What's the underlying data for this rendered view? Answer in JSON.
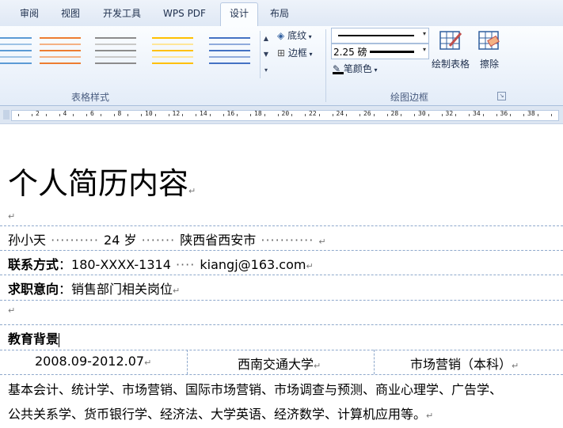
{
  "tabs": [
    {
      "label": "审阅",
      "active": false
    },
    {
      "label": "视图",
      "active": false
    },
    {
      "label": "开发工具",
      "active": false
    },
    {
      "label": "WPS PDF",
      "active": false
    },
    {
      "label": "设计",
      "active": true
    },
    {
      "label": "布局",
      "active": false
    }
  ],
  "ribbon": {
    "style_group_label": "表格样式",
    "border_group_label": "绘图边框",
    "shading_label": "底纹",
    "borders_label": "边框",
    "pen_weight": "2.25 磅",
    "pen_color_label": "笔颜色",
    "draw_table_label": "绘制表格",
    "eraser_label": "擦除",
    "style_colors": [
      "#5b9bd5",
      "#ed7d31",
      "#a5a5a5",
      "#ffc000",
      "#4472c4"
    ]
  },
  "ruler": {
    "numbers": [
      "2",
      "4",
      "6",
      "8",
      "10",
      "12",
      "14",
      "16",
      "18",
      "20",
      "22",
      "24",
      "26",
      "28",
      "30",
      "32",
      "34",
      "36",
      "38"
    ]
  },
  "document": {
    "title": "个人简历内容",
    "name": "孙小天",
    "age": "24 岁",
    "location": "陕西省西安市",
    "contact_label": "联系方式",
    "phone": "：180-XXXX-1314",
    "email": "kiangj@163.com",
    "intent_label": "求职意向",
    "intent_value": "：销售部门相关岗位",
    "education_label": "教育背景",
    "edu_period": "2008.09-2012.07",
    "edu_school": "西南交通大学",
    "edu_major": "市场营销（本科）",
    "courses_line1": "基本会计、统计学、市场营销、国际市场营销、市场调查与预测、商业心理学、广告学、",
    "courses_line2": "公共关系学、货币银行学、经济法、大学英语、经济数学、计算机应用等。"
  }
}
